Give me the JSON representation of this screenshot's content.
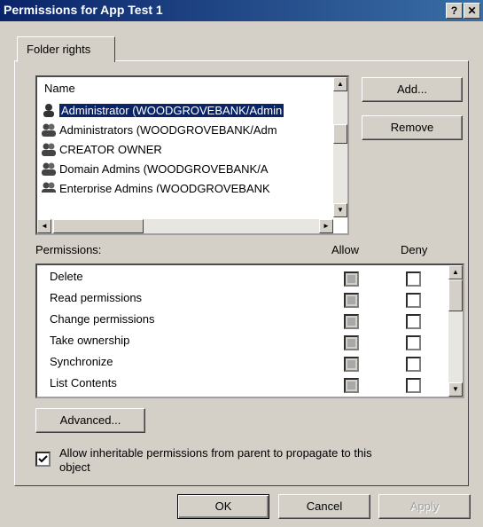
{
  "window": {
    "title": "Permissions for App Test 1",
    "help_btn": "?",
    "close_btn": "✕"
  },
  "tabs": [
    {
      "label": "Folder rights"
    }
  ],
  "names": {
    "header": "Name",
    "items": [
      "Administrator (WOODGROVEBANK/Admin",
      "Administrators (WOODGROVEBANK/Adm",
      "CREATOR OWNER",
      "Domain Admins (WOODGROVEBANK/A",
      "Enterprise Admins (WOODGROVEBANK"
    ],
    "selected_index": 0
  },
  "buttons": {
    "add": "Add...",
    "remove": "Remove",
    "advanced": "Advanced...",
    "ok": "OK",
    "cancel": "Cancel",
    "apply": "Apply"
  },
  "permissions": {
    "label": "Permissions:",
    "allow_header": "Allow",
    "deny_header": "Deny",
    "items": [
      {
        "name": "Delete",
        "allow": true,
        "deny": false
      },
      {
        "name": "Read permissions",
        "allow": true,
        "deny": false
      },
      {
        "name": "Change permissions",
        "allow": true,
        "deny": false
      },
      {
        "name": "Take ownership",
        "allow": true,
        "deny": false
      },
      {
        "name": "Synchronize",
        "allow": true,
        "deny": false
      },
      {
        "name": "List Contents",
        "allow": true,
        "deny": false
      }
    ]
  },
  "inherit": {
    "checked": true,
    "label_line1": "Allow inheritable permissions from parent to propagate to this",
    "label_line2": "object"
  },
  "scroll_icons": {
    "up": "▲",
    "down": "▼",
    "left": "◄",
    "right": "►"
  }
}
